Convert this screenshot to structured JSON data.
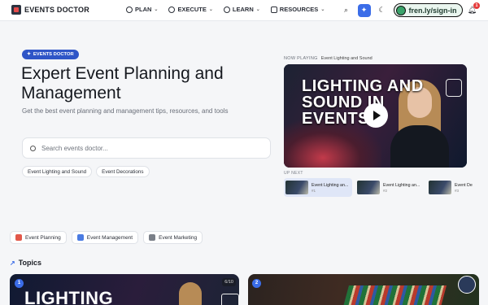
{
  "brand": {
    "name": "EVENTS DOCTOR"
  },
  "nav": {
    "items": [
      {
        "label": "PLAN",
        "icon": "compass-icon"
      },
      {
        "label": "EXECUTE",
        "icon": "check-circle-icon"
      },
      {
        "label": "LEARN",
        "icon": "check-circle-icon"
      },
      {
        "label": "RESOURCES",
        "icon": "grid-icon"
      }
    ],
    "signin_label": "fren.ly/sign-in",
    "notification_count": "1"
  },
  "hero": {
    "tag": "EVENTS DOCTOR",
    "title": "Expert Event Planning and Management",
    "subtitle": "Get the best event planning and management tips, resources, and tools",
    "search_placeholder": "Search events doctor...",
    "chips": [
      "Event Lighting and Sound",
      "Event Decorations"
    ]
  },
  "player": {
    "now_playing_label": "NOW PLAYING",
    "now_playing_title": "Event Lighting and Sound",
    "video_title": "LIGHTING AND SOUND IN EVENTS",
    "up_next_label": "UP NEXT",
    "queue": [
      {
        "title": "Event Lighting an...",
        "num": "#1"
      },
      {
        "title": "Event Lighting an...",
        "num": "#2"
      },
      {
        "title": "Event De",
        "num": "#3"
      }
    ]
  },
  "categories": [
    {
      "label": "Event Planning",
      "color": "#e2584a"
    },
    {
      "label": "Event Management",
      "color": "#4a7be2"
    },
    {
      "label": "Event Marketing",
      "color": "#7a7f88"
    }
  ],
  "topics": {
    "heading": "Topics",
    "cards": [
      {
        "num": "1",
        "title": "LIGHTING",
        "count": "6/10"
      },
      {
        "num": "2"
      }
    ]
  }
}
